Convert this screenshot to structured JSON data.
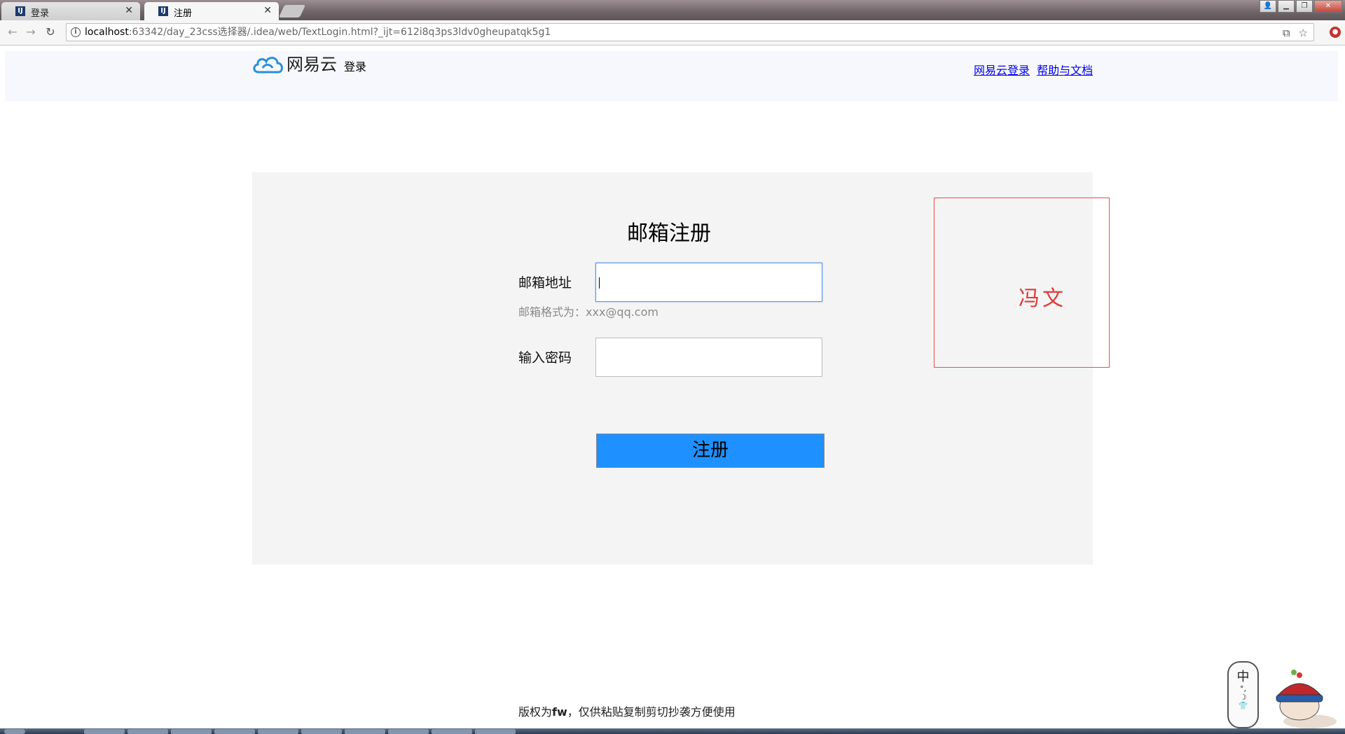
{
  "browser": {
    "tabs": [
      {
        "title": "登录",
        "active": false
      },
      {
        "title": "注册",
        "active": true
      }
    ],
    "url_host": "localhost",
    "url_rest": ":63342/day_23css选择器/.idea/web/TextLogin.html?_ijt=612i8q3ps3ldv0gheupatqk5g1"
  },
  "header": {
    "logo_text": "网易云",
    "logo_sub": "登录",
    "links": [
      "网易云登录",
      "帮助与文档"
    ]
  },
  "form": {
    "title": "邮箱注册",
    "email_label": "邮箱地址",
    "email_hint": "邮箱格式为：xxx@qq.com",
    "email_value": "",
    "password_label": "输入密码",
    "password_value": "",
    "submit_label": "注册"
  },
  "side_box": {
    "text": "冯文",
    "border_color": "#e84d4d"
  },
  "footer": {
    "prefix": "版权为",
    "owner": "fw",
    "suffix": "，仅供粘贴复制剪切抄袭方便使用"
  },
  "ime": {
    "mode": "中"
  },
  "colors": {
    "accent": "#1e90ff",
    "panel": "#f4f4f4",
    "header": "#f7f8fd"
  }
}
